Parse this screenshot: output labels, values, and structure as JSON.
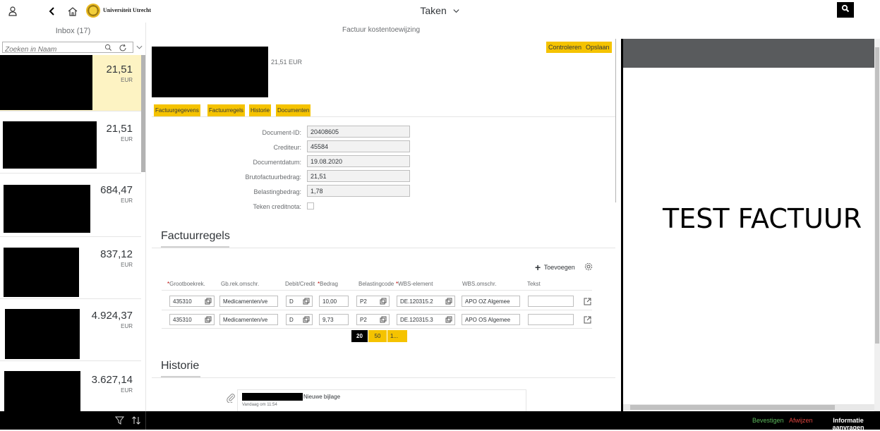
{
  "shell": {
    "title": "Taken",
    "logo_text": "Universiteit Utrecht",
    "icons": [
      "person-icon",
      "back-icon",
      "home-icon",
      "search-icon"
    ]
  },
  "master": {
    "title": "Inbox (17)",
    "search_placeholder": "Zoeken in Naam",
    "items": [
      {
        "amount": "21,51",
        "currency": "EUR",
        "selected": true
      },
      {
        "amount": "21,51",
        "currency": "EUR"
      },
      {
        "amount": "684,47",
        "currency": "EUR"
      },
      {
        "amount": "837,12",
        "currency": "EUR"
      },
      {
        "amount": "4.924,37",
        "currency": "EUR"
      },
      {
        "amount": "3.627,14",
        "currency": "EUR"
      }
    ]
  },
  "detail": {
    "title": "Factuur kostentoewijzing",
    "header_amount": "21,51 EUR",
    "actions": {
      "check": "Controleren",
      "save": "Opslaan"
    },
    "tabs": [
      "Factuurgegevens",
      "Factuurregels",
      "Historie",
      "Documenten"
    ],
    "fields": [
      {
        "label": "Document-ID:",
        "value": "20408605"
      },
      {
        "label": "Crediteur:",
        "value": "45584"
      },
      {
        "label": "Documentdatum:",
        "value": "19.08.2020"
      },
      {
        "label": "Brutofactuurbedrag:",
        "value": "21,51"
      },
      {
        "label": "Belastingbedrag:",
        "value": "1,78"
      }
    ],
    "credit_note_label": "Teken creditnota:",
    "credit_note_checked": false,
    "lines_section": {
      "title": "Factuurregels",
      "add_label": "Toevoegen",
      "columns": [
        "Grootboekrek.",
        "Gb.rek.omschr.",
        "Debit/Credit",
        "Bedrag",
        "Belastingcode",
        "WBS-element",
        "WBS.omschr.",
        "Tekst"
      ],
      "required_columns": [
        "Grootboekrek.",
        "Bedrag",
        "WBS-element"
      ],
      "rows": [
        {
          "account": "435310",
          "account_desc": "Medicamenten/ve",
          "dc": "D",
          "amount": "10,00",
          "tax": "P2",
          "wbs": "DE.120315.2",
          "wbs_desc": "APO OZ Algemee",
          "text": ""
        },
        {
          "account": "435310",
          "account_desc": "Medicamenten/ve",
          "dc": "D",
          "amount": "9,73",
          "tax": "P2",
          "wbs": "DE.120315.3",
          "wbs_desc": "APO OS Algemee",
          "text": ""
        }
      ],
      "page_sizes": [
        "20",
        "50",
        "1..."
      ],
      "active_page_size": "20"
    },
    "history_section": {
      "title": "Historie",
      "entries": [
        {
          "text": "Nieuwe bijlage",
          "time": "Vandaag om 11:54"
        }
      ]
    }
  },
  "preview": {
    "document_text": "TEST FACTUUR"
  },
  "footer": {
    "confirm": "Bevestigen",
    "reject": "Afwijzen",
    "request_info": "Informatie aanvragen",
    "colors": {
      "confirm": "#5cb85c",
      "reject": "#e0443e",
      "request_info": "#ffffff"
    }
  },
  "colors": {
    "accent": "#f5c300",
    "selected_row": "#fdf3c3",
    "shell_bg": "#ffffff",
    "footer_bg": "#000000"
  }
}
